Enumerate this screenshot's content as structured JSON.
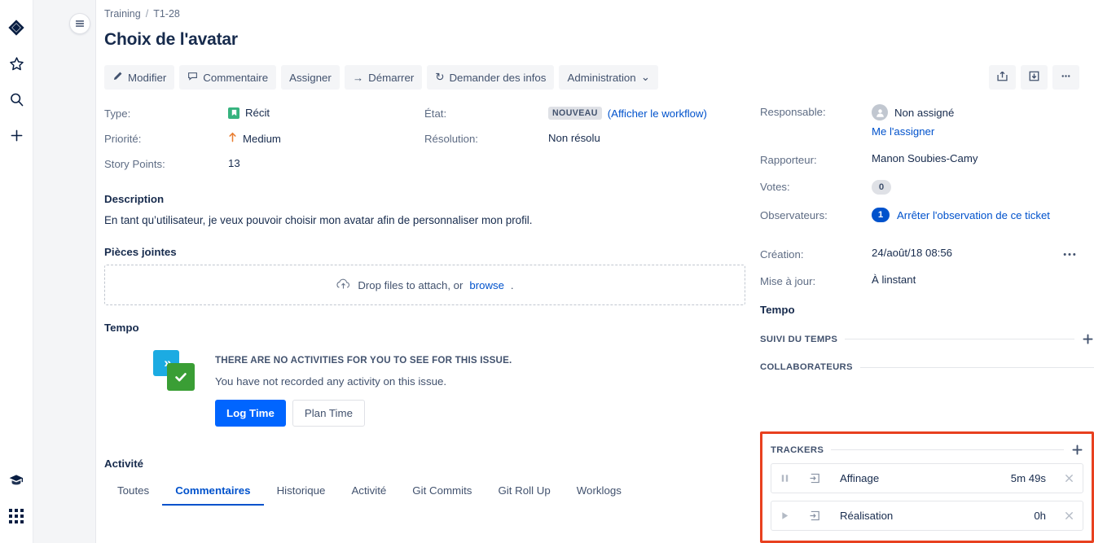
{
  "rail": {
    "icons": [
      {
        "name": "jira-logo-icon",
        "label": "Jira"
      },
      {
        "name": "star-icon",
        "label": "Favoris"
      },
      {
        "name": "search-icon",
        "label": "Rechercher"
      },
      {
        "name": "plus-icon",
        "label": "Créer"
      }
    ],
    "bottom_icons": [
      {
        "name": "graduation-cap-icon",
        "label": "Aide"
      },
      {
        "name": "app-grid-icon",
        "label": "Applications"
      }
    ]
  },
  "sidebar": {
    "toggle_icon": "hamburger-icon"
  },
  "breadcrumb": {
    "project": "Training",
    "separator": "/",
    "issue_key": "T1-28"
  },
  "header": {
    "title": "Choix de l'avatar"
  },
  "toolbar": {
    "edit_label": "Modifier",
    "comment_label": "Commentaire",
    "assign_label": "Assigner",
    "start_label": "Démarrer",
    "start_icon_text": "→",
    "request_info_label": "Demander des infos",
    "request_info_icon_text": "↻",
    "admin_label": "Administration",
    "admin_caret": "⌄",
    "share_icon": "share-icon",
    "export_icon": "export-icon",
    "more_icon": "ellipsis-icon"
  },
  "fields": {
    "type_label": "Type:",
    "type_value": "Récit",
    "priority_label": "Priorité:",
    "priority_value": "Medium",
    "story_points_label": "Story Points:",
    "story_points_value": "13",
    "status_label": "État:",
    "status_value": "NOUVEAU",
    "workflow_link": "(Afficher le workflow)",
    "resolution_label": "Résolution:",
    "resolution_value": "Non résolu"
  },
  "description": {
    "heading": "Description",
    "text": "En tant qu’utilisateur, je veux pouvoir choisir mon avatar afin de personnaliser mon profil."
  },
  "attachments": {
    "heading": "Pièces jointes",
    "more_icon": "ellipsis-icon",
    "dropzone_text": "Drop files to attach, or",
    "dropzone_link": "browse",
    "dropzone_period": "."
  },
  "tempo": {
    "heading": "Tempo",
    "empty_title": "THERE ARE NO ACTIVITIES FOR YOU TO SEE FOR THIS ISSUE.",
    "empty_sub": "You have not recorded any activity on this issue.",
    "log_time_label": "Log Time",
    "plan_time_label": "Plan Time"
  },
  "activity": {
    "heading": "Activité",
    "tabs": [
      {
        "label": "Toutes",
        "active": false
      },
      {
        "label": "Commentaires",
        "active": true
      },
      {
        "label": "Historique",
        "active": false
      },
      {
        "label": "Activité",
        "active": false
      },
      {
        "label": "Git Commits",
        "active": false
      },
      {
        "label": "Git Roll Up",
        "active": false
      },
      {
        "label": "Worklogs",
        "active": false
      }
    ]
  },
  "people": {
    "assignee_label": "Responsable:",
    "assignee_value": "Non assigné",
    "assign_to_me": "Me l'assigner",
    "reporter_label": "Rapporteur:",
    "reporter_value": "Manon Soubies-Camy",
    "votes_label": "Votes:",
    "votes_value": "0",
    "watchers_label": "Observateurs:",
    "watchers_value": "1",
    "watchers_link": "Arrêter l'observation de ce ticket"
  },
  "dates": {
    "created_label": "Création:",
    "created_value": "24/août/18 08:56",
    "updated_label": "Mise à jour:",
    "updated_value": "À linstant"
  },
  "right_tempo": {
    "title": "Tempo",
    "time_tracking_label": "Suivi du temps",
    "collaborators_label": "Collaborateurs",
    "add_icon": "plus-icon"
  },
  "trackers": {
    "label": "Trackers",
    "add_icon": "plus-icon",
    "highlight_color": "#e8401f",
    "rows": [
      {
        "name": "Affinage",
        "time": "5m 49s",
        "state": "running",
        "control_icon": "pause-icon",
        "log_icon": "log-time-icon",
        "close_icon": "close-icon"
      },
      {
        "name": "Réalisation",
        "time": "0h",
        "state": "paused",
        "control_icon": "play-icon",
        "log_icon": "log-time-icon",
        "close_icon": "close-icon"
      }
    ]
  }
}
